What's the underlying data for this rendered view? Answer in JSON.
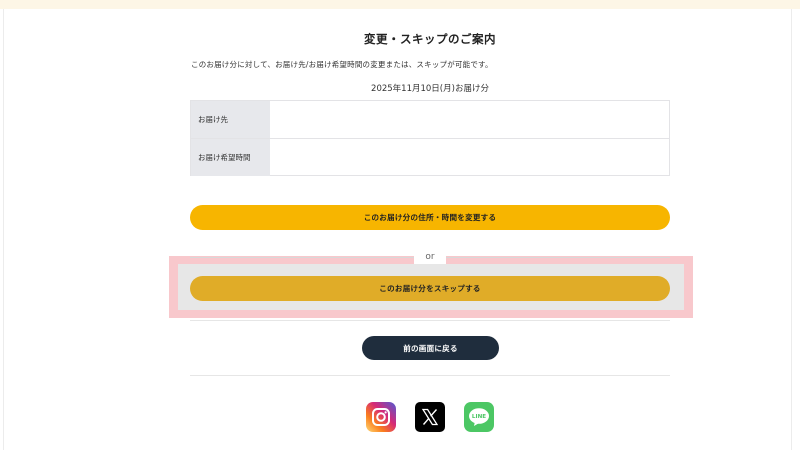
{
  "page": {
    "title": "変更・スキップのご案内",
    "intro": "このお届け分に対して、お届け先/お届け希望時間の変更または、スキップが可能です。",
    "delivery_date": "2025年11月10日(月)お届け分"
  },
  "info_table": {
    "rows": [
      {
        "label": "お届け先",
        "value": ""
      },
      {
        "label": "お届け希望時間",
        "value": ""
      }
    ]
  },
  "actions": {
    "change_label": "このお届け分の住所・時間を変更する",
    "or_label": "or",
    "skip_label": "このお届け分をスキップする",
    "back_label": "前の画面に戻る"
  },
  "social": {
    "icons": [
      "instagram-icon",
      "x-icon",
      "line-icon"
    ],
    "line_text": "LINE"
  },
  "colors": {
    "change_button": "#f7b500",
    "skip_button": "#e0ac28",
    "back_button": "#1f2d3d",
    "highlight": "#f8c8cc",
    "line_green": "#4cc764"
  }
}
